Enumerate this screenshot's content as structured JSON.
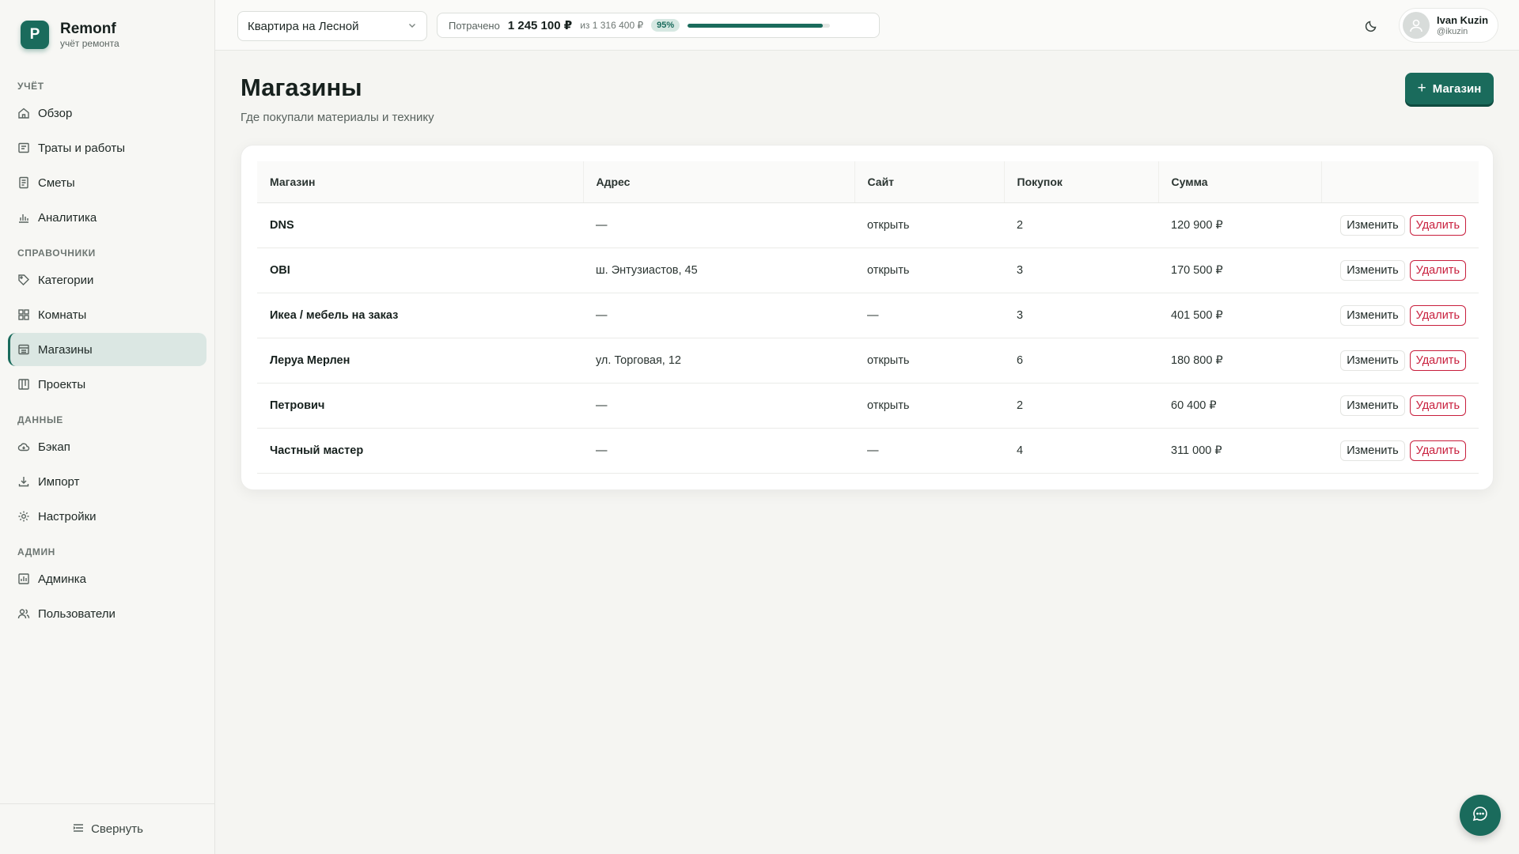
{
  "brand": {
    "logo_letter": "P",
    "name": "Remonf",
    "subtitle": "учёт ремонта"
  },
  "sidebar": {
    "sections": [
      {
        "title": "УЧЁТ",
        "items": [
          {
            "label": "Обзор",
            "icon": "home-icon"
          },
          {
            "label": "Траты и работы",
            "icon": "receipt-icon"
          },
          {
            "label": "Сметы",
            "icon": "estimate-icon"
          },
          {
            "label": "Аналитика",
            "icon": "bar-chart-icon"
          }
        ]
      },
      {
        "title": "СПРАВОЧНИКИ",
        "items": [
          {
            "label": "Категории",
            "icon": "tag-icon"
          },
          {
            "label": "Комнаты",
            "icon": "grid-icon"
          },
          {
            "label": "Магазины",
            "icon": "store-icon",
            "active": true
          },
          {
            "label": "Проекты",
            "icon": "kanban-icon"
          }
        ]
      },
      {
        "title": "ДАННЫЕ",
        "items": [
          {
            "label": "Бэкап",
            "icon": "cloud-icon"
          },
          {
            "label": "Импорт",
            "icon": "import-icon"
          },
          {
            "label": "Настройки",
            "icon": "gear-icon"
          }
        ]
      },
      {
        "title": "АДМИН",
        "items": [
          {
            "label": "Админка",
            "icon": "admin-icon"
          },
          {
            "label": "Пользователи",
            "icon": "users-icon"
          }
        ]
      }
    ],
    "collapse_label": "Свернуть"
  },
  "topbar": {
    "project": "Квартира на Лесной",
    "budget": {
      "label": "Потрачено",
      "spent": "1 245 100 ₽",
      "of": "из 1 316 400 ₽",
      "percent_label": "95%",
      "progress": 0.95
    },
    "user": {
      "name": "Ivan Kuzin",
      "handle": "@ikuzin"
    }
  },
  "page": {
    "title": "Магазины",
    "subtitle": "Где покупали материалы и технику",
    "add_button": "Магазин"
  },
  "table": {
    "columns": [
      "Магазин",
      "Адрес",
      "Сайт",
      "Покупок",
      "Сумма",
      ""
    ],
    "edit_label": "Изменить",
    "delete_label": "Удалить",
    "rows": [
      {
        "name": "DNS",
        "address": "—",
        "site": "открыть",
        "purchases": "2",
        "sum": "120 900 ₽"
      },
      {
        "name": "OBI",
        "address": "ш. Энтузиастов, 45",
        "site": "открыть",
        "purchases": "3",
        "sum": "170 500 ₽"
      },
      {
        "name": "Икеа / мебель на заказ",
        "address": "—",
        "site": "—",
        "purchases": "3",
        "sum": "401 500 ₽"
      },
      {
        "name": "Леруа Мерлен",
        "address": "ул. Торговая, 12",
        "site": "открыть",
        "purchases": "6",
        "sum": "180 800 ₽"
      },
      {
        "name": "Петрович",
        "address": "—",
        "site": "открыть",
        "purchases": "2",
        "sum": "60 400 ₽"
      },
      {
        "name": "Частный мастер",
        "address": "—",
        "site": "—",
        "purchases": "4",
        "sum": "311 000 ₽"
      }
    ]
  },
  "colors": {
    "accent": "#1a6b5c",
    "danger": "#c81e3c"
  }
}
